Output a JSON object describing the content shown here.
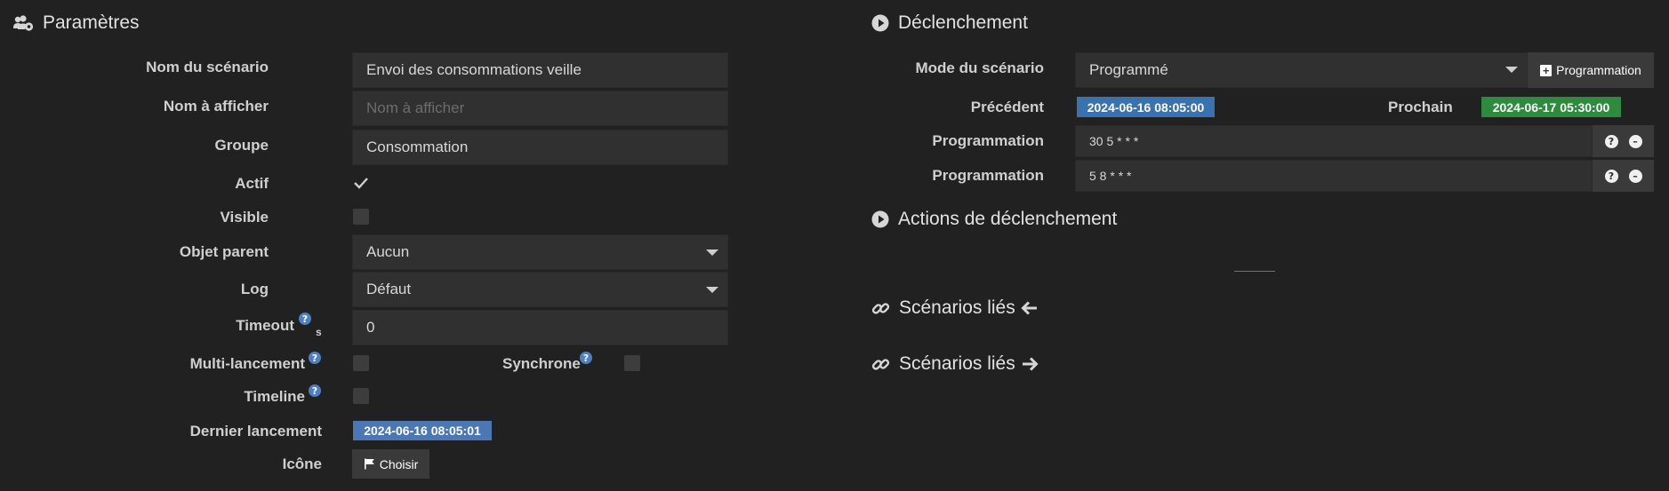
{
  "colors": {
    "background": "#212121",
    "input_bg": "#303030",
    "blue_badge": "#3a72b0",
    "green_badge": "#2e8b3e",
    "date_badge": "#4b77b5",
    "help_icon": "#4f7fc1"
  },
  "params": {
    "title": "Paramètres",
    "icon": "users-cog-icon",
    "name_label": "Nom du scénario",
    "name_value": "Envoi des consommations veille",
    "display_name_label": "Nom à afficher",
    "display_name_placeholder": "Nom à afficher",
    "group_label": "Groupe",
    "group_value": "Consommation",
    "active_label": "Actif",
    "active_checked": true,
    "visible_label": "Visible",
    "visible_checked": false,
    "parent_label": "Objet parent",
    "parent_value": "Aucun",
    "log_label": "Log",
    "log_value": "Défaut",
    "timeout_label": "Timeout",
    "timeout_unit": "s",
    "timeout_value": "0",
    "multi_label": "Multi-lancement",
    "multi_checked": false,
    "sync_label": "Synchrone",
    "sync_checked": false,
    "timeline_label": "Timeline",
    "timeline_checked": false,
    "last_run_label": "Dernier lancement",
    "last_run_value": "2024-06-16 08:05:01",
    "icon_label": "Icône",
    "choose_label": "Choisir"
  },
  "trigger": {
    "title": "Déclenchement",
    "icon": "play-circle-icon",
    "mode_label": "Mode du scénario",
    "mode_value": "Programmé",
    "add_program_label": "Programmation",
    "previous_label": "Précédent",
    "previous_value": "2024-06-16 08:05:00",
    "next_label": "Prochain",
    "next_value": "2024-06-17 05:30:00",
    "schedules": [
      {
        "label": "Programmation",
        "value": "30 5 * * *"
      },
      {
        "label": "Programmation",
        "value": "5 8 * * *"
      }
    ]
  },
  "actions": {
    "title": "Actions de déclenchement",
    "icon": "play-circle-icon"
  },
  "linked_in": {
    "title": "Scénarios liés",
    "icon": "link-icon",
    "arrow": "arrow-left-icon"
  },
  "linked_out": {
    "title": "Scénarios liés",
    "icon": "link-icon",
    "arrow": "arrow-right-icon"
  }
}
